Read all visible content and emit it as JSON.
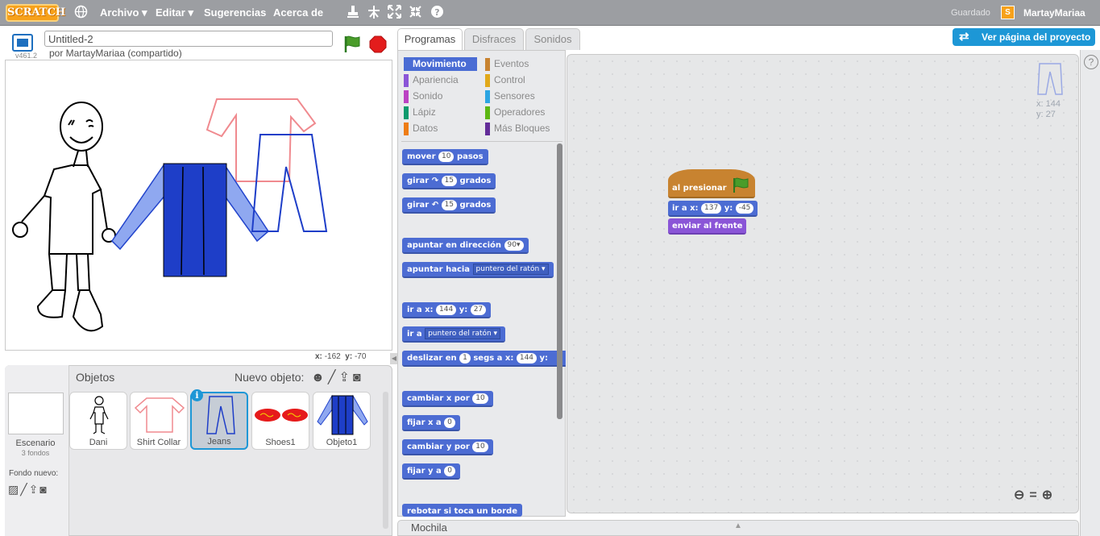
{
  "menubar": {
    "logo": "SCRATCH",
    "items": [
      "Archivo ▾",
      "Editar ▾",
      "Sugerencias",
      "Acerca de"
    ],
    "saved_status": "Guardado",
    "username": "MartayMariaa",
    "icons": [
      "globe-icon",
      "stamp-icon",
      "cut-icon",
      "grow-icon",
      "shrink-icon",
      "help-icon"
    ]
  },
  "stage_header": {
    "project_title": "Untitled-2",
    "by_line": "por MartayMariaa (compartido)",
    "version": "v461.2"
  },
  "stage": {
    "mouse_x_label": "x:",
    "mouse_x": "-162",
    "mouse_y_label": "y:",
    "mouse_y": "-70"
  },
  "sprite_pane": {
    "title": "Objetos",
    "new_sprite_label": "Nuevo objeto:",
    "stage_label": "Escenario",
    "stage_backdrops": "3 fondos",
    "new_backdrop_label": "Fondo nuevo:",
    "sprites": [
      {
        "name": "Dani"
      },
      {
        "name": "Shirt Collar"
      },
      {
        "name": "Jeans",
        "selected": true
      },
      {
        "name": "Shoes1"
      },
      {
        "name": "Objeto1"
      }
    ]
  },
  "tabs": [
    "Programas",
    "Disfraces",
    "Sonidos"
  ],
  "project_page_button": "Ver página del proyecto",
  "categories": {
    "left": [
      {
        "label": "Movimiento",
        "color": "#4a6cd4",
        "active": true
      },
      {
        "label": "Apariencia",
        "color": "#8a55d7"
      },
      {
        "label": "Sonido",
        "color": "#bb42c3"
      },
      {
        "label": "Lápiz",
        "color": "#0e9a6c"
      },
      {
        "label": "Datos",
        "color": "#ee7d16"
      }
    ],
    "right": [
      {
        "label": "Eventos",
        "color": "#c88330"
      },
      {
        "label": "Control",
        "color": "#e1a91a"
      },
      {
        "label": "Sensores",
        "color": "#2ca5e2"
      },
      {
        "label": "Operadores",
        "color": "#5cb712"
      },
      {
        "label": "Más Bloques",
        "color": "#632d99"
      }
    ]
  },
  "palette_blocks": {
    "mover": {
      "pre": "mover",
      "num": "10",
      "post": "pasos"
    },
    "girar_r": {
      "pre": "girar",
      "icon": "↷",
      "num": "15",
      "post": "grados"
    },
    "girar_l": {
      "pre": "girar",
      "icon": "↶",
      "num": "15",
      "post": "grados"
    },
    "apuntar_dir": {
      "pre": "apuntar en dirección",
      "num": "90▾"
    },
    "apuntar_hacia": {
      "pre": "apuntar hacia",
      "drop": "puntero del ratón ▾"
    },
    "ir_xy": {
      "pre": "ir a x:",
      "x": "144",
      "mid": "y:",
      "y": "27"
    },
    "ir_a": {
      "pre": "ir a",
      "drop": "puntero del ratón ▾"
    },
    "deslizar": {
      "pre": "deslizar en",
      "num": "1",
      "mid": "segs a x:",
      "x": "144",
      "post": "y:"
    },
    "cambiar_x": {
      "pre": "cambiar x por",
      "num": "10"
    },
    "fijar_x": {
      "pre": "fijar x a",
      "num": "0"
    },
    "cambiar_y": {
      "pre": "cambiar y por",
      "num": "10"
    },
    "fijar_y": {
      "pre": "fijar y a",
      "num": "0"
    },
    "rebotar": {
      "pre": "rebotar si toca un borde"
    }
  },
  "scripts": {
    "sprite_x": "x: 144",
    "sprite_y": "y: 27",
    "hat": "al presionar",
    "goto": {
      "pre": "ir a x:",
      "x": "137",
      "mid": "y:",
      "y": "-45"
    },
    "front": "enviar al frente"
  },
  "backpack_label": "Mochila"
}
